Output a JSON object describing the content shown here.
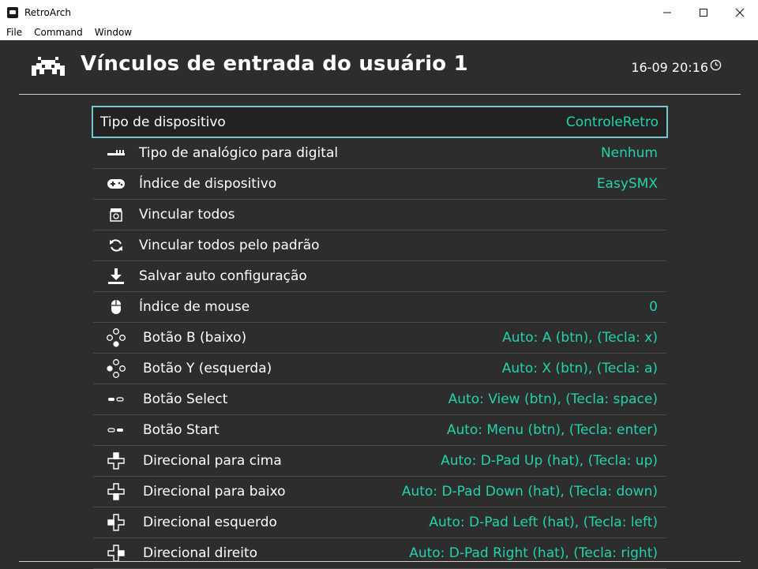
{
  "window": {
    "title": "RetroArch",
    "minimize_glyph": "—",
    "maximize_glyph": "☐",
    "close_glyph": "✕"
  },
  "menubar": {
    "items": [
      "File",
      "Command",
      "Window"
    ]
  },
  "header": {
    "title": "Vínculos de entrada do usuário 1",
    "clock": "16-09 20:16",
    "logo_icon": "retroarch-invader-icon",
    "clock_icon": "clock-icon"
  },
  "colors": {
    "background": "#2d2d2d",
    "value_text": "#22d3aa",
    "selection_border": "#78c7cf",
    "text": "#ffffff"
  },
  "rows": [
    {
      "label": "Tipo de dispositivo",
      "value": "ControleRetro",
      "icon": "none",
      "selected": true
    },
    {
      "label": "Tipo de analógico para digital",
      "value": "Nenhum",
      "icon": "analog-stick-icon"
    },
    {
      "label": "Índice de dispositivo",
      "value": "EasySMX",
      "icon": "gamepad-icon"
    },
    {
      "label": "Vincular todos",
      "value": "",
      "icon": "bind-all-icon"
    },
    {
      "label": "Vincular todos pelo padrão",
      "value": "",
      "icon": "reset-icon"
    },
    {
      "label": "Salvar auto configuração",
      "value": "",
      "icon": "save-download-icon"
    },
    {
      "label": "Índice de mouse",
      "value": "0",
      "icon": "mouse-icon"
    },
    {
      "label": "Botão B (baixo)",
      "value": "Auto:  A (btn), (Tecla: x)",
      "icon": "face-button-down-icon"
    },
    {
      "label": "Botão Y (esquerda)",
      "value": "Auto:  X (btn), (Tecla: a)",
      "icon": "face-button-left-icon"
    },
    {
      "label": "Botão Select",
      "value": "Auto:  View (btn), (Tecla: space)",
      "icon": "select-button-icon"
    },
    {
      "label": "Botão Start",
      "value": "Auto:  Menu (btn), (Tecla: enter)",
      "icon": "start-button-icon"
    },
    {
      "label": "Direcional para cima",
      "value": "Auto:  D-Pad Up (hat), (Tecla: up)",
      "icon": "dpad-up-icon"
    },
    {
      "label": "Direcional para baixo",
      "value": "Auto:  D-Pad Down (hat), (Tecla: down)",
      "icon": "dpad-down-icon"
    },
    {
      "label": "Direcional esquerdo",
      "value": "Auto:  D-Pad Left (hat), (Tecla: left)",
      "icon": "dpad-left-icon"
    },
    {
      "label": "Direcional direito",
      "value": "Auto:  D-Pad Right (hat), (Tecla: right)",
      "icon": "dpad-right-icon"
    }
  ]
}
